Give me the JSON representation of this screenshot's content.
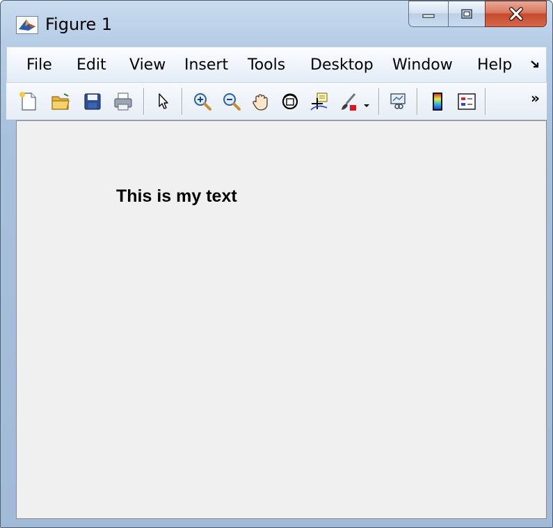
{
  "window": {
    "title": "Figure 1"
  },
  "menu": {
    "items": [
      "File",
      "Edit",
      "View",
      "Insert",
      "Tools",
      "Desktop",
      "Window",
      "Help"
    ],
    "dock_icon": "undock-arrow-icon"
  },
  "toolbar": {
    "icons": [
      "new-figure-icon",
      "open-file-icon",
      "save-figure-icon",
      "print-figure-icon",
      "edit-plot-arrow-icon",
      "zoom-in-icon",
      "zoom-out-icon",
      "pan-hand-icon",
      "rotate-3d-icon",
      "data-cursor-icon",
      "brush-icon",
      "link-plot-icon",
      "colorbar-icon",
      "legend-icon"
    ],
    "overflow_label": "»"
  },
  "figure": {
    "text": "This is my text"
  },
  "colors": {
    "accent": "#1e3a8a",
    "close_red": "#c64a2e",
    "canvas": "#f0f0f0"
  }
}
